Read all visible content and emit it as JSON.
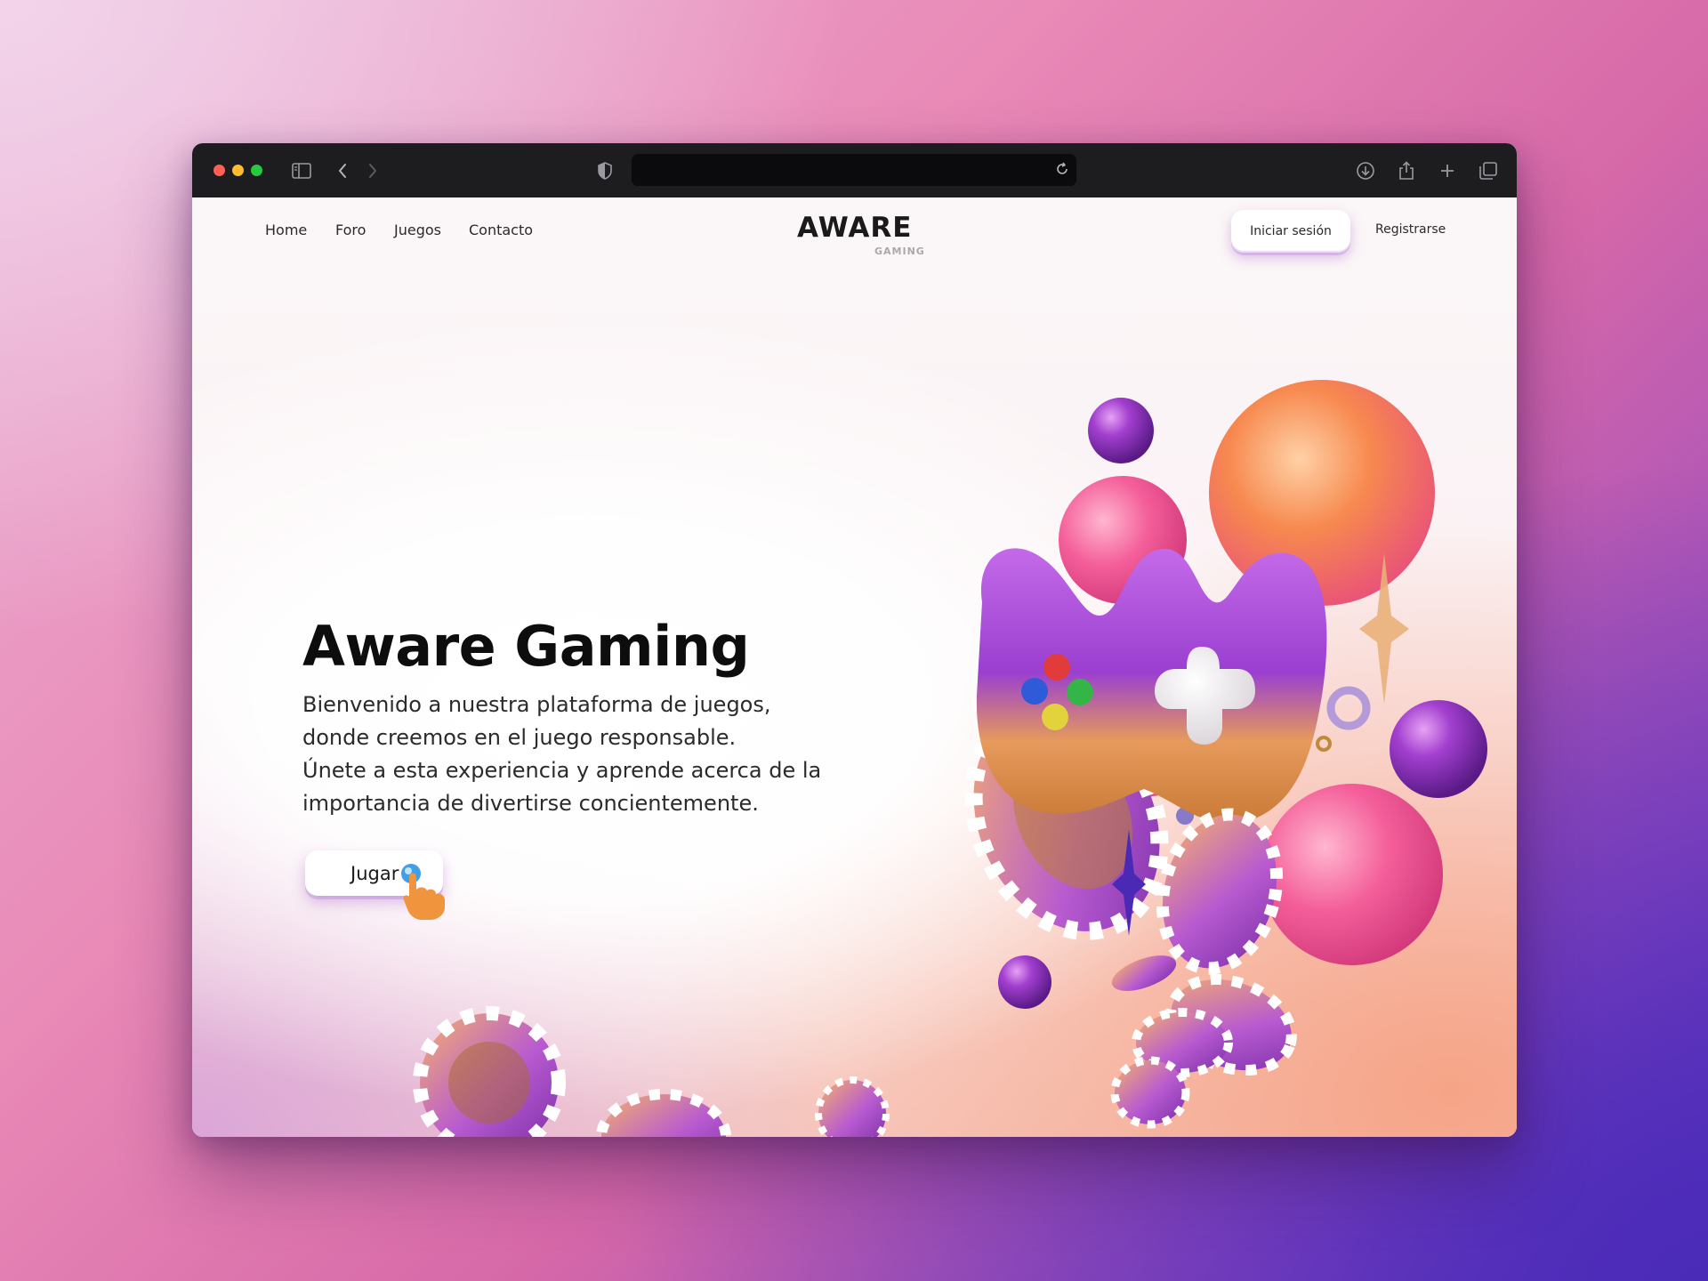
{
  "browser": {
    "address_value": "",
    "icons": [
      "sidebar-icon",
      "back-icon",
      "forward-icon",
      "shield-icon",
      "reload-icon",
      "download-icon",
      "share-icon",
      "new-tab-icon",
      "tabs-overview-icon"
    ]
  },
  "nav": {
    "links": [
      "Home",
      "Foro",
      "Juegos",
      "Contacto"
    ]
  },
  "logo": {
    "main": "AWARE",
    "sub": "GAMING"
  },
  "auth": {
    "login_label": "Iniciar sesión",
    "register_label": "Registrarse"
  },
  "hero": {
    "title": "Aware Gaming",
    "lines": [
      "Bienvenido a nuestra plataforma de juegos,",
      "donde creemos en el juego responsable.",
      "Únete a esta experiencia y aprende acerca de la",
      "importancia de divertirse concientemente."
    ],
    "cta_label": "Jugar"
  },
  "colors": {
    "accent_purple": "#a84fd8",
    "accent_orange": "#f39a4a",
    "accent_pink": "#f06ba8"
  }
}
